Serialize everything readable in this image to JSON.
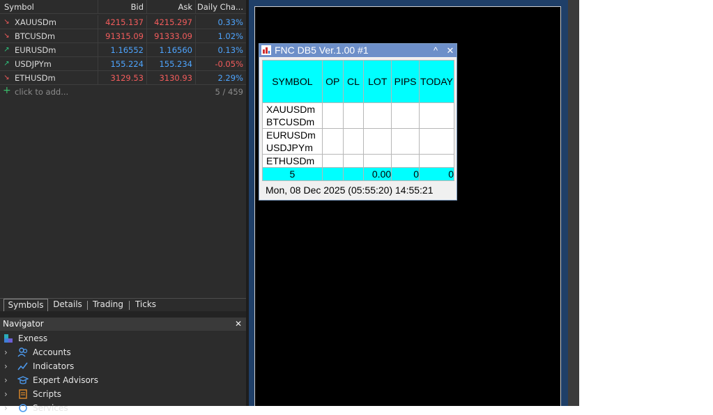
{
  "market_watch": {
    "headers": {
      "symbol": "Symbol",
      "bid": "Bid",
      "ask": "Ask",
      "change": "Daily Cha..."
    },
    "rows": [
      {
        "symbol": "XAUUSDm",
        "bid": "4215.137",
        "ask": "4215.297",
        "change": "0.33%",
        "direction": "down",
        "price_color": "#f35c5c",
        "change_color": "#4ea5ff",
        "arrow_color": "#f35c5c"
      },
      {
        "symbol": "BTCUSDm",
        "bid": "91315.09",
        "ask": "91333.09",
        "change": "1.02%",
        "direction": "down",
        "price_color": "#f35c5c",
        "change_color": "#4ea5ff",
        "arrow_color": "#f35c5c"
      },
      {
        "symbol": "EURUSDm",
        "bid": "1.16552",
        "ask": "1.16560",
        "change": "0.13%",
        "direction": "up",
        "price_color": "#4ea5ff",
        "change_color": "#4ea5ff",
        "arrow_color": "#2ec47d"
      },
      {
        "symbol": "USDJPYm",
        "bid": "155.224",
        "ask": "155.234",
        "change": "-0.05%",
        "direction": "up",
        "price_color": "#4ea5ff",
        "change_color": "#f35c5c",
        "arrow_color": "#2ec47d"
      },
      {
        "symbol": "ETHUSDm",
        "bid": "3129.53",
        "ask": "3130.93",
        "change": "2.29%",
        "direction": "down",
        "price_color": "#f35c5c",
        "change_color": "#4ea5ff",
        "arrow_color": "#f35c5c"
      }
    ],
    "add_label": "click to add...",
    "count": "5 / 459",
    "tabs": [
      "Symbols",
      "Details",
      "Trading",
      "Ticks"
    ]
  },
  "navigator": {
    "title": "Navigator",
    "close": "✕",
    "root": "Exness",
    "items": [
      "Accounts",
      "Indicators",
      "Expert Advisors",
      "Scripts",
      "Services"
    ]
  },
  "dialog": {
    "title": "FNC DB5 Ver.1.00 #1",
    "columns": [
      "SYMBOL",
      "OP",
      "CL",
      "LOT",
      "PIPS",
      "TODAY"
    ],
    "symbols": [
      "XAUUSDm",
      "BTCUSDm",
      "EURUSDm",
      "USDJPYm",
      "ETHUSDm"
    ],
    "summary": {
      "count": "5",
      "op": "",
      "cl": "",
      "lot": "0.00",
      "pips": "0",
      "today": "0"
    },
    "datetime": "Mon, 08 Dec 2025  (05:55:20)  14:55:21"
  }
}
